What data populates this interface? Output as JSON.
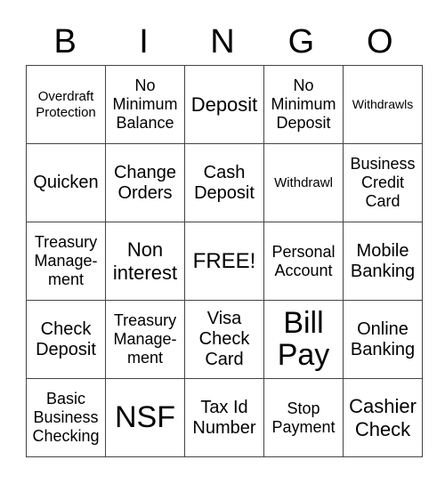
{
  "header": [
    "B",
    "I",
    "N",
    "G",
    "O"
  ],
  "rows": [
    [
      "Overdraft\nProtection",
      "No\nMinimum\nBalance",
      "Deposit",
      "No\nMinimum\nDeposit",
      "Withdrawls"
    ],
    [
      "Quicken",
      "Change\nOrders",
      "Cash\nDeposit",
      "Withdrawl",
      "Business\nCredit\nCard"
    ],
    [
      "Treasury\nManage-\nment",
      "Non\ninterest",
      "FREE!",
      "Personal\nAccount",
      "Mobile\nBanking"
    ],
    [
      "Check\nDeposit",
      "Treasury\nManage-\nment",
      "Visa\nCheck\nCard",
      "Bill\nPay",
      "Online\nBanking"
    ],
    [
      "Basic\nBusiness\nChecking",
      "NSF",
      "Tax Id\nNumber",
      "Stop\nPayment",
      "Cashier\nCheck"
    ]
  ],
  "colors": {
    "border": "#444444",
    "text": "#000000",
    "background": "#ffffff"
  }
}
